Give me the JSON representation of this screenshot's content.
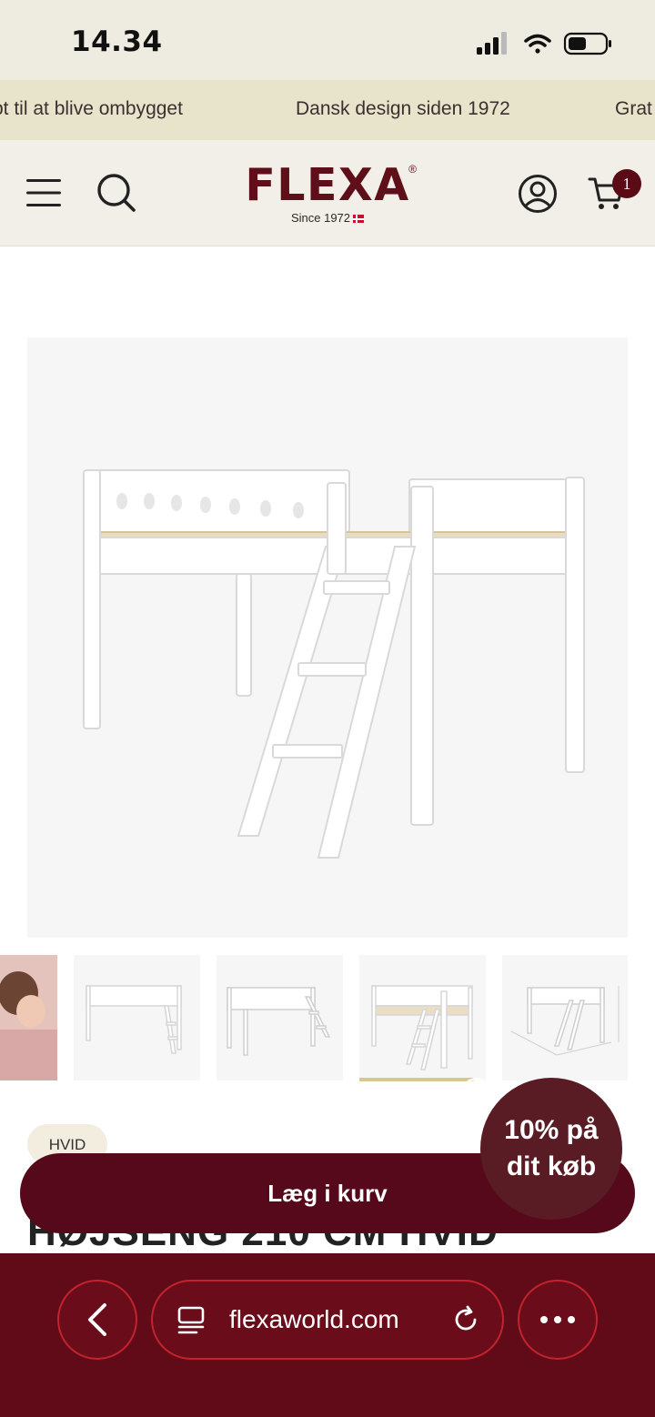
{
  "status_bar": {
    "time": "14.34"
  },
  "marquee": {
    "items": [
      "pt til at blive ombygget",
      "Dansk design siden 1972",
      "Grat"
    ]
  },
  "header": {
    "logo_text": "FLEXA",
    "logo_registered": "®",
    "logo_since": "Since 1972",
    "cart_count": "1"
  },
  "product": {
    "color_label": "HVID",
    "title": "HØJSENG 210 CM HVID",
    "thumbnail_count": 5,
    "active_thumbnail": 3
  },
  "actions": {
    "add_to_cart_label": "Læg i kurv"
  },
  "promo": {
    "line1": "10% på",
    "line2": "dit køb"
  },
  "browser": {
    "url": "flexaworld.com"
  },
  "colors": {
    "brand": "#5e0f1a",
    "button": "#56091a",
    "browser_bar": "#610a18",
    "marquee_bg": "#e8e4cb",
    "header_bg": "#f1efe7"
  }
}
